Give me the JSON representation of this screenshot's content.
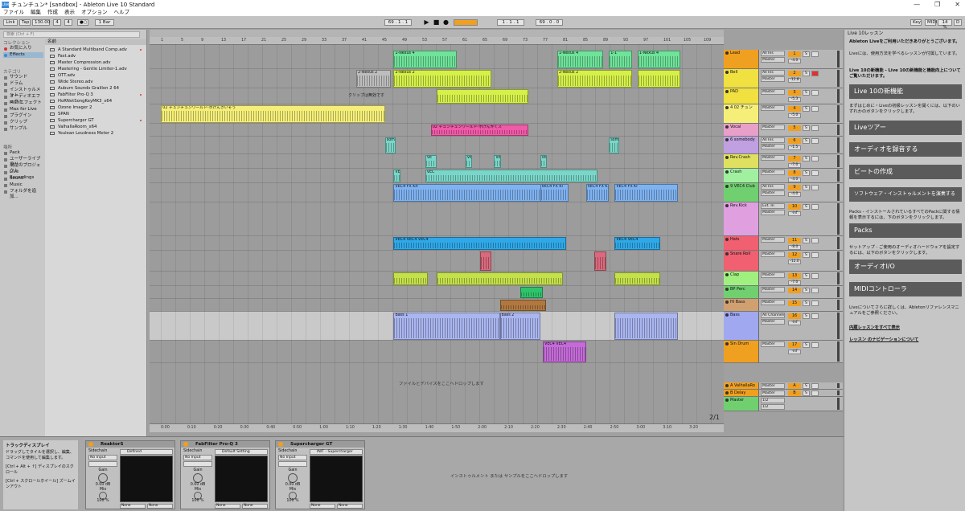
{
  "window": {
    "title": "チュンチュン* [sandbox] - Ableton Live 10 Standard",
    "app_icon": "Live",
    "controls": [
      "—",
      "❐",
      "✕"
    ]
  },
  "menu": [
    "ファイル",
    "編集",
    "作成",
    "表示",
    "オプション",
    "ヘルプ"
  ],
  "transport": {
    "link": "Link",
    "tap": "Tap",
    "tempo": "130.00",
    "sig_num": "4",
    "sig_den": "4",
    "metronome": "●○",
    "quantize": "1 Bar",
    "arr_pos": "69 . 1 . 1",
    "punch": "1 . 1 . 1",
    "loop_len": "69 . 0 . 0",
    "key": "Key",
    "midi": "MIDI",
    "cpu": "14 %",
    "d": "D"
  },
  "browser": {
    "search_placeholder": "検索 (Ctrl + F)",
    "collections_header": "コレクション",
    "collections": [
      "お気に入り",
      "Effects"
    ],
    "categories_header": "カテゴリ",
    "categories": [
      "サウンド",
      "ドラム",
      "インストゥルメント",
      "オーディオエフェクト",
      "MIDIエフェクト",
      "Max for Live",
      "プラグイン",
      "クリップ",
      "サンプル"
    ],
    "places_header": "場所",
    "places": [
      "Pack",
      "ユーザーライブラリ",
      "現在のプロジェクト",
      "Live Recordings",
      "Sound",
      "Music",
      "フォルダを追加..."
    ],
    "name_header": "名前",
    "files": [
      {
        "name": "A Standard Multiband Comp.adv",
        "mark": true
      },
      {
        "name": "Fast.adv",
        "mark": false
      },
      {
        "name": "Master Compression.adv",
        "mark": false
      },
      {
        "name": "Mastering - Gentle Limiter-1.adv",
        "mark": false
      },
      {
        "name": "OTT.adv",
        "mark": false
      },
      {
        "name": "Wide Stereo.adv",
        "mark": false
      },
      {
        "name": "Auburn Sounds Graillon 2 64",
        "mark": false
      },
      {
        "name": "FabFilter Pro-Q 3",
        "mark": true
      },
      {
        "name": "HoRNetSongKeyMK3_x64",
        "mark": false
      },
      {
        "name": "Ozone Imager 2",
        "mark": false
      },
      {
        "name": "SPAN",
        "mark": false
      },
      {
        "name": "Supercharger GT",
        "mark": true
      },
      {
        "name": "ValhallaRoom_x64",
        "mark": false
      },
      {
        "name": "Youlean Loudness Meter 2",
        "mark": false
      }
    ]
  },
  "arrangement": {
    "ruler": [
      "1",
      "5",
      "9",
      "13",
      "17",
      "21",
      "25",
      "29",
      "33",
      "37",
      "41",
      "45",
      "49",
      "53",
      "57",
      "61",
      "65",
      "69",
      "73",
      "77",
      "81",
      "85",
      "89",
      "93",
      "97",
      "101",
      "105",
      "109"
    ],
    "time": [
      "0:00",
      "0:10",
      "0:20",
      "0:30",
      "0:40",
      "0:50",
      "1:00",
      "1:10",
      "1:20",
      "1:30",
      "1:40",
      "1:50",
      "2:00",
      "2:10",
      "2:20",
      "2:30",
      "2:40",
      "2:50",
      "3:00",
      "3:10",
      "3:20"
    ],
    "drop_hint": "ファイルとデバイスをここへドロップします",
    "clip_empty": "クリップは無効です",
    "zoom": "2/1",
    "clips": [
      {
        "lane": 0,
        "start": 0.425,
        "len": 0.11,
        "color": "#6fe39a",
        "name": "1-Nexus 4"
      },
      {
        "lane": 0,
        "start": 0.71,
        "len": 0.08,
        "color": "#6fe39a",
        "name": "1-Nexus 4"
      },
      {
        "lane": 0,
        "start": 0.8,
        "len": 0.04,
        "color": "#6fe39a",
        "name": "1-1"
      },
      {
        "lane": 0,
        "start": 0.85,
        "len": 0.075,
        "color": "#6fe39a",
        "name": "1-Nexus 4"
      },
      {
        "lane": 1,
        "start": 0.36,
        "len": 0.06,
        "color": "#bdbdbd",
        "name": "2-Nexus 2"
      },
      {
        "lane": 1,
        "start": 0.425,
        "len": 0.17,
        "color": "#d6f04a",
        "name": "2-Nexus 2"
      },
      {
        "lane": 1,
        "start": 0.71,
        "len": 0.13,
        "color": "#d6f04a",
        "name": "2-Nexus 2"
      },
      {
        "lane": 1,
        "start": 0.85,
        "len": 0.075,
        "color": "#d6f04a",
        "name": ""
      },
      {
        "lane": 2,
        "start": 0.5,
        "len": 0.16,
        "color": "#d6f04a",
        "name": ""
      },
      {
        "lane": 3,
        "start": 0.02,
        "len": 0.39,
        "color": "#f5ef7a",
        "name": "02 チュンチュンワールド-ホげんきいそう"
      },
      {
        "lane": 4,
        "start": 0.49,
        "len": 0.17,
        "color": "#f05aa8",
        "name": "02 チュンチュンワールド-ホげんキくス"
      },
      {
        "lane": 5,
        "start": 0.41,
        "len": 0.018,
        "color": "#7ad6c8",
        "name": "somb"
      },
      {
        "lane": 5,
        "start": 0.8,
        "len": 0.018,
        "color": "#7ad6c8",
        "name": "somb"
      },
      {
        "lane": 6,
        "start": 0.48,
        "len": 0.02,
        "color": "#7ad6c8",
        "name": "VE"
      },
      {
        "lane": 6,
        "start": 0.55,
        "len": 0.012,
        "color": "#7ad6c8",
        "name": "VE"
      },
      {
        "lane": 6,
        "start": 0.6,
        "len": 0.012,
        "color": "#7ad6c8",
        "name": "VE"
      },
      {
        "lane": 6,
        "start": 0.68,
        "len": 0.012,
        "color": "#7ad6c8",
        "name": "VE"
      },
      {
        "lane": 7,
        "start": 0.425,
        "len": 0.012,
        "color": "#7ad6c8",
        "name": "VE"
      },
      {
        "lane": 7,
        "start": 0.48,
        "len": 0.3,
        "color": "#7ad6c8",
        "name": "VEC"
      },
      {
        "lane": 8,
        "start": 0.425,
        "len": 0.26,
        "color": "#7fb2f0",
        "name": "VEC4 FX Kit"
      },
      {
        "lane": 8,
        "start": 0.68,
        "len": 0.05,
        "color": "#7fb2f0",
        "name": "VEC4 FX Ki"
      },
      {
        "lane": 8,
        "start": 0.76,
        "len": 0.04,
        "color": "#7fb2f0",
        "name": "VEC4 FX Ki"
      },
      {
        "lane": 8,
        "start": 0.81,
        "len": 0.11,
        "color": "#7fb2f0",
        "name": "VEC4 FX Ki"
      },
      {
        "lane": 10,
        "start": 0.425,
        "len": 0.3,
        "color": "#2fa8e8",
        "name": "VEC4 VEC4 VEC4"
      },
      {
        "lane": 10,
        "start": 0.81,
        "len": 0.08,
        "color": "#2fa8e8",
        "name": "VEC4 VEC4"
      },
      {
        "lane": 11,
        "start": 0.575,
        "len": 0.02,
        "color": "#d96a7e",
        "name": ""
      },
      {
        "lane": 11,
        "start": 0.775,
        "len": 0.02,
        "color": "#d96a7e",
        "name": ""
      },
      {
        "lane": 12,
        "start": 0.425,
        "len": 0.06,
        "color": "#c4e04a",
        "name": ""
      },
      {
        "lane": 12,
        "start": 0.5,
        "len": 0.22,
        "color": "#c4e04a",
        "name": ""
      },
      {
        "lane": 12,
        "start": 0.81,
        "len": 0.08,
        "color": "#c4e04a",
        "name": ""
      },
      {
        "lane": 13,
        "start": 0.645,
        "len": 0.04,
        "color": "#2fc46a",
        "name": ""
      },
      {
        "lane": 14,
        "start": 0.61,
        "len": 0.08,
        "color": "#b07840",
        "name": ""
      },
      {
        "lane": 15,
        "start": 0.425,
        "len": 0.185,
        "color": "#aab6f0",
        "name": "Bass 1"
      },
      {
        "lane": 15,
        "start": 0.61,
        "len": 0.07,
        "color": "#aab6f0",
        "name": "Bass 2"
      },
      {
        "lane": 15,
        "start": 0.81,
        "len": 0.11,
        "color": "#aab6f0",
        "name": ""
      },
      {
        "lane": 16,
        "start": 0.685,
        "len": 0.075,
        "color": "#c46bd8",
        "name": "VEC4 VEC4"
      }
    ]
  },
  "tracks": [
    {
      "name": "Lead",
      "color": "#f0a020",
      "num": "1",
      "in": "All Ins",
      "out": "Master",
      "vol": "-4.0",
      "pan": "C",
      "h": 24
    },
    {
      "name": "Bell",
      "color": "#f0e040",
      "num": "2",
      "in": "All Ins",
      "out": "Master",
      "vol": "-12.8",
      "pan": "C",
      "h": 24
    },
    {
      "name": "PAD",
      "color": "#f0e040",
      "num": "3",
      "in": "",
      "out": "Master",
      "vol": "-5.3",
      "pan": "C",
      "h": 20
    },
    {
      "name": "4 02 チュン",
      "color": "#f5ef7a",
      "num": "4",
      "in": "",
      "out": "Master",
      "vol": "-5.0",
      "pan": "C",
      "h": 24
    },
    {
      "name": "Vocal",
      "color": "#e8a0c8",
      "num": "5",
      "in": "",
      "out": "Master",
      "vol": "-3.5",
      "pan": "C",
      "h": 16
    },
    {
      "name": "6 somebody",
      "color": "#c0a0e0",
      "num": "6",
      "in": "All Ins",
      "out": "Master",
      "vol": "-1.5",
      "pan": "C",
      "h": 22
    },
    {
      "name": "Rev.Crash",
      "color": "#e0e060",
      "num": "7",
      "in": "",
      "out": "Master",
      "vol": "-7.0",
      "pan": "C",
      "h": 18
    },
    {
      "name": "Crash",
      "color": "#a0f0a0",
      "num": "8",
      "in": "",
      "out": "Master",
      "vol": "-4.0",
      "pan": "C",
      "h": 18
    },
    {
      "name": "9 VEC4 Club",
      "color": "#70d070",
      "num": "9",
      "in": "All Ins",
      "out": "Master",
      "vol": "-4.0",
      "pan": "C",
      "h": 24
    },
    {
      "name": "Rev.Kick",
      "color": "#e0a0e0",
      "num": "10",
      "in": "Ext. In",
      "out": "Master",
      "vol": "-inf",
      "pan": "C",
      "h": 42
    },
    {
      "name": "Hats",
      "color": "#f06070",
      "num": "11",
      "in": "",
      "out": "Master",
      "vol": "-8.0",
      "pan": "C",
      "h": 18
    },
    {
      "name": "Snare Roll",
      "color": "#f06070",
      "num": "12",
      "in": "",
      "out": "Master",
      "vol": "-12.0",
      "pan": "C",
      "h": 26
    },
    {
      "name": "Clap",
      "color": "#a0f080",
      "num": "13",
      "in": "",
      "out": "Master",
      "vol": "-7.0",
      "pan": "C",
      "h": 18
    },
    {
      "name": "BP Perc",
      "color": "#70d070",
      "num": "14",
      "in": "",
      "out": "Master",
      "vol": "-4.0",
      "pan": "C",
      "h": 16
    },
    {
      "name": "Hi Bass",
      "color": "#d0a070",
      "num": "15",
      "in": "",
      "out": "Master",
      "vol": "-5.0",
      "pan": "C",
      "h": 16
    },
    {
      "name": "Bass",
      "color": "#a0a8f0",
      "num": "16",
      "in": "All Channels",
      "out": "Master",
      "vol": "-inf",
      "pan": "C",
      "h": 36
    },
    {
      "name": "Sin Drum",
      "color": "#f0a020",
      "num": "17",
      "in": "",
      "out": "Master",
      "vol": "-inf",
      "pan": "C",
      "h": 28
    },
    {
      "name": "A ValhallaRo",
      "color": "#f0a020",
      "num": "A",
      "in": "",
      "out": "Master",
      "vol": "",
      "pan": "",
      "h": 9,
      "gap": 24
    },
    {
      "name": "B Delay",
      "color": "#f0a020",
      "num": "B",
      "in": "",
      "out": "Master",
      "vol": "",
      "pan": "",
      "h": 9
    },
    {
      "name": "Master",
      "color": "#70d070",
      "num": "",
      "in": "1/2",
      "out": "1/2",
      "vol": "",
      "pan": "",
      "h": 18
    }
  ],
  "lesson": {
    "title": "Live 10レッスン",
    "intro_bold": "Ableton Liveをご利用いただきありがとうございます。",
    "intro": "Liveには、使用方法を学べるレッスンが付属しています。",
    "new_feat": "Live 10の新機能 - Live 10の新機能と機能向上についてご覧いただけます。",
    "btn_new": "Live 10の新機能",
    "start_text": "まずはじめに・Liveの初級レッスンを開くには、以下のいずれかのボタンをクリックします。",
    "btn_tour": "Liveツアー",
    "btn_record": "オーディオを録音する",
    "btn_beat": "ビートの作成",
    "btn_soft": "ソフトウェア・インストゥルメントを演奏する",
    "packs_text": "Packs - インストールされているすべてのPackに関する情報を表示するには、下のボタンをクリックします。",
    "btn_packs": "Packs",
    "setup_text": "セットアップ - ご使用のオーディオハードウェアを設定するには、以下のボタンをクリックします。",
    "btn_audio": "オーディオI/O",
    "btn_midi": "MIDIコントローラ",
    "more_text": "Liveについてさらに詳しくは、Abletonリファレンスマニュアルをご参照ください。",
    "link_all": "内蔵レッスンをすべて表示",
    "link_nav": "レッスン のナビゲーションについて"
  },
  "info_view": {
    "title": "トラックディスプレイ",
    "body1": "ドラッグしてタイルを選択し、編集、コマンドを使用して編集します。",
    "body2": "[Ctrl + Alt + ↑] ディスプレイのスクロール",
    "body3": "[Ctrl + スクロールホイール] ズームインアウト"
  },
  "devices": [
    {
      "name": "ReaktorS",
      "sidechain": "Sidechain",
      "input": "No Input",
      "preset": "Defined",
      "gain_label": "Gain",
      "gain": "0.00 dB",
      "mix_label": "Mix",
      "mix": "100 %",
      "foot1": "None",
      "foot2": "None"
    },
    {
      "name": "FabFilter Pro-Q 3",
      "sidechain": "Sidechain",
      "input": "No Input",
      "preset": "Default Setting",
      "gain_label": "Gain",
      "gain": "0.00 dB",
      "mix_label": "Mix",
      "mix": "100 %",
      "foot1": "None",
      "foot2": "None"
    },
    {
      "name": "Supercharger GT",
      "sidechain": "Sidechain",
      "input": "No Input",
      "preset": "INIT - Supercharger",
      "gain_label": "Gain",
      "gain": "0.00 dB",
      "mix_label": "Mix",
      "mix": "100 %",
      "foot1": "None",
      "foot2": "None"
    }
  ],
  "device_drop_hint": "インストゥルメント または サンプルをここへドロップします"
}
